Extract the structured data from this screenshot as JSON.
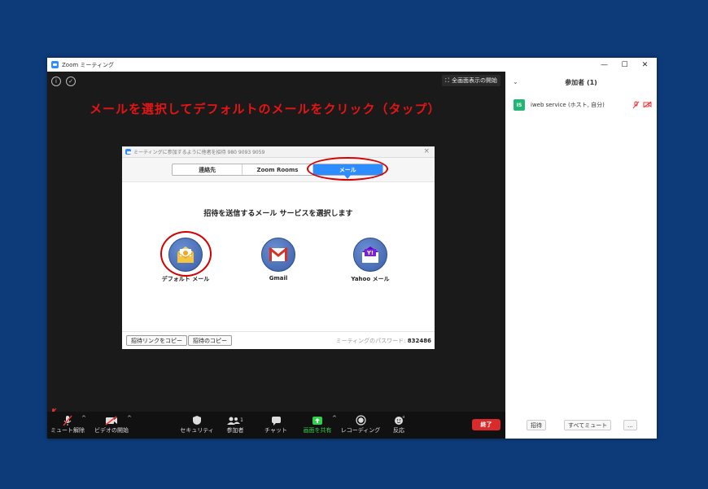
{
  "window": {
    "title": "Zoom ミーティング",
    "minimize": "—",
    "maximize": "☐",
    "close": "✕"
  },
  "meeting": {
    "fullscreen_label": "全画面表示の開始",
    "instruction": "メールを選択してデフォルトのメールをクリック（タップ）"
  },
  "dialog": {
    "title": "ミーティングに参加するように他者を招待 980 9093 9059",
    "tabs": [
      {
        "label": "連絡先"
      },
      {
        "label": "Zoom Rooms"
      },
      {
        "label": "メール"
      }
    ],
    "prompt": "招待を送信するメール サービスを選択します",
    "services": [
      {
        "label": "デフォルト メール",
        "icon": "default-mail-icon"
      },
      {
        "label": "Gmail",
        "icon": "gmail-icon"
      },
      {
        "label": "Yahoo メール",
        "icon": "yahoo-mail-icon"
      }
    ],
    "copy_link": "招待リンクをコピー",
    "copy_invite": "招待のコピー",
    "password_label": "ミーティングのパスワード:",
    "password_value": "832486"
  },
  "toolbar": {
    "items": [
      {
        "label": "ミュート解除",
        "icon": "mic-muted-icon"
      },
      {
        "label": "ビデオの開始",
        "icon": "video-off-icon"
      },
      {
        "label": "セキュリティ",
        "icon": "shield-icon"
      },
      {
        "label": "参加者",
        "icon": "participants-icon",
        "count": "1"
      },
      {
        "label": "チャット",
        "icon": "chat-icon"
      },
      {
        "label": "画面を共有",
        "icon": "share-screen-icon"
      },
      {
        "label": "レコーディング",
        "icon": "record-icon"
      },
      {
        "label": "反応",
        "icon": "reaction-icon"
      }
    ],
    "end_label": "終了",
    "colors": {
      "share": "#2fd14b",
      "end": "#d92b2b"
    }
  },
  "participants": {
    "header": "参加者 (1)",
    "list": [
      {
        "initials": "IS",
        "name": "iweb service (ホスト, 自分)"
      }
    ],
    "invite_label": "招待",
    "mute_all_label": "すべてミュート",
    "more_label": "..."
  }
}
